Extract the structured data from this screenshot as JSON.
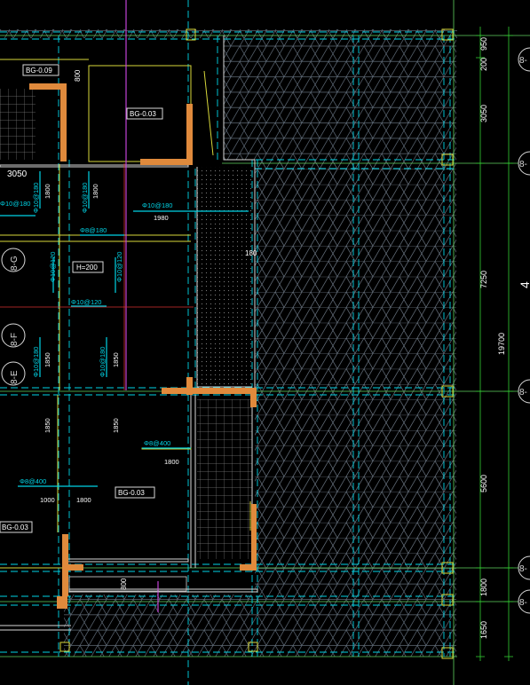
{
  "colors": {
    "background": "#000000",
    "hatch": "#5f6b78",
    "hatch_light": "#7c8894",
    "grid_white": "#d9d9d9",
    "dim_green": "#33cc33",
    "axis_green": "#5fd35f",
    "rebar_cyan": "#00d4e6",
    "wall_orange": "#e08a3c",
    "wall_face": "#f0a85a",
    "yellow": "#d8d83a",
    "magenta": "#c043d6",
    "red": "#d63131",
    "white_text": "#ffffff"
  },
  "dimensions_right": {
    "segments": [
      "950",
      "200",
      "3050",
      "7250",
      "5600",
      "1800",
      "1650"
    ],
    "total": "19700"
  },
  "axis_bubbles": {
    "right": [
      "8-",
      "8-",
      "8-",
      "8-",
      "8-"
    ],
    "left": [
      "8-G",
      "8-F",
      "8-E"
    ]
  },
  "labels": {
    "bg_minus_009": "BG-0.09",
    "bg_003_top": "BG-0.03",
    "bg_003_mid": "BG-0.03",
    "bg_003_left": "BG-0.03",
    "h200": "H=200",
    "dim_3050": "3050",
    "dim_800_top": "800",
    "dim_800_bottom": "800",
    "dim_180": "180",
    "right_partial": "4"
  },
  "rebar_text": {
    "r1": "Φ10@180",
    "r2": "Φ10@180",
    "r3": "Φ10@180",
    "r4": "Φ10@180",
    "r5": "Φ8@180",
    "r6": "Φ10@120",
    "r7": "Φ10@120",
    "r8": "Φ10@120",
    "r9": "Φ10@180",
    "r10": "Φ10@180",
    "r11": "Φ8@400",
    "r12": "Φ8@400",
    "len_1800_a": "1800",
    "len_1800_b": "1800",
    "len_1980": "1980",
    "len_1850_a": "1850",
    "len_1850_b": "1850",
    "len_1850_c": "1850",
    "len_1850_d": "1850",
    "len_1800_c": "1800",
    "len_1000": "1000",
    "len_1800_d": "1800"
  }
}
